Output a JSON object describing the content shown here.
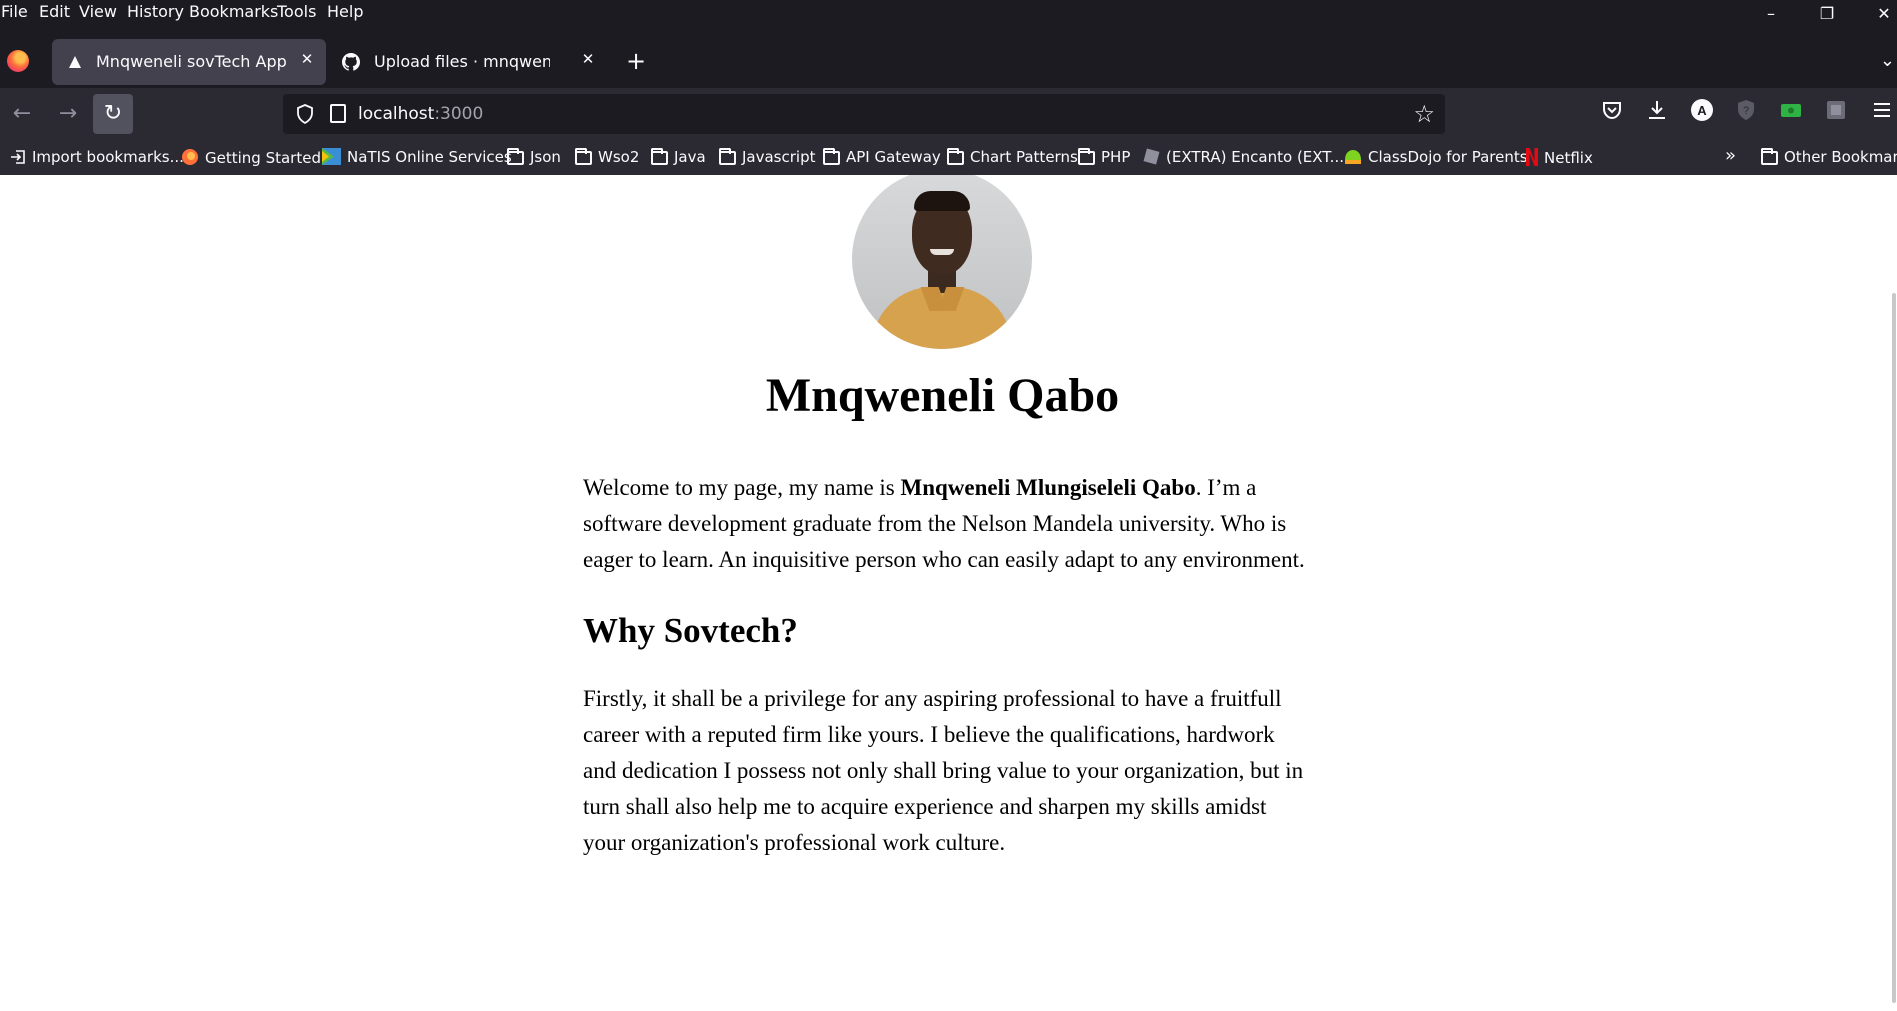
{
  "menu": [
    "File",
    "Edit",
    "View",
    "History",
    "Bookmarks",
    "Tools",
    "Help"
  ],
  "tabs": [
    {
      "title": "Mnqweneli sovTech App",
      "active": true,
      "favicon": "triangle-icon"
    },
    {
      "title": "Upload files · mnqweneli/Qabo",
      "active": false,
      "favicon": "github-icon"
    }
  ],
  "url": {
    "host": "localhost",
    "port": ":3000"
  },
  "bookmarks": [
    {
      "label": "Import bookmarks...",
      "icon": "import-icon"
    },
    {
      "label": "Getting Started",
      "icon": "firefox-icon"
    },
    {
      "label": "NaTIS Online Services",
      "icon": "natis-icon"
    },
    {
      "label": "Json",
      "icon": "folder-icon"
    },
    {
      "label": "Wso2",
      "icon": "folder-icon"
    },
    {
      "label": "Java",
      "icon": "folder-icon"
    },
    {
      "label": "Javascript",
      "icon": "folder-icon"
    },
    {
      "label": "API Gateway",
      "icon": "folder-icon"
    },
    {
      "label": "Chart Patterns",
      "icon": "folder-icon"
    },
    {
      "label": "PHP",
      "icon": "folder-icon"
    },
    {
      "label": "(EXTRA) Encanto  (EXT...",
      "icon": "roblox-icon"
    },
    {
      "label": "ClassDojo for Parents",
      "icon": "classdojo-icon"
    },
    {
      "label": "Netflix",
      "icon": "netflix-icon"
    }
  ],
  "other_bookmarks": "Other Bookmarks",
  "profile": {
    "name": "Mnqweneli Qabo",
    "intro_before": "Welcome to my page, my name is ",
    "intro_bold": "Mnqweneli Mlungiseleli Qabo",
    "intro_after": ". I’m a software development graduate from the Nelson Mandela university. Who is eager to learn. An inquisitive person who can easily adapt to any environment.",
    "section_heading": "Why Sovtech?",
    "section_text": "Firstly, it shall be a privilege for any aspiring professional to have a fruitfull career with a reputed firm like yours. I believe the qualifications, hardwork and dedication I possess not only shall bring value to your organization, but in turn shall also help me to acquire experience and sharpen my skills amidst your organization's professional work culture."
  },
  "colors": {
    "chrome_bg": "#1c1b22",
    "toolbar_bg": "#2b2a33",
    "active_tab": "#42414d"
  }
}
